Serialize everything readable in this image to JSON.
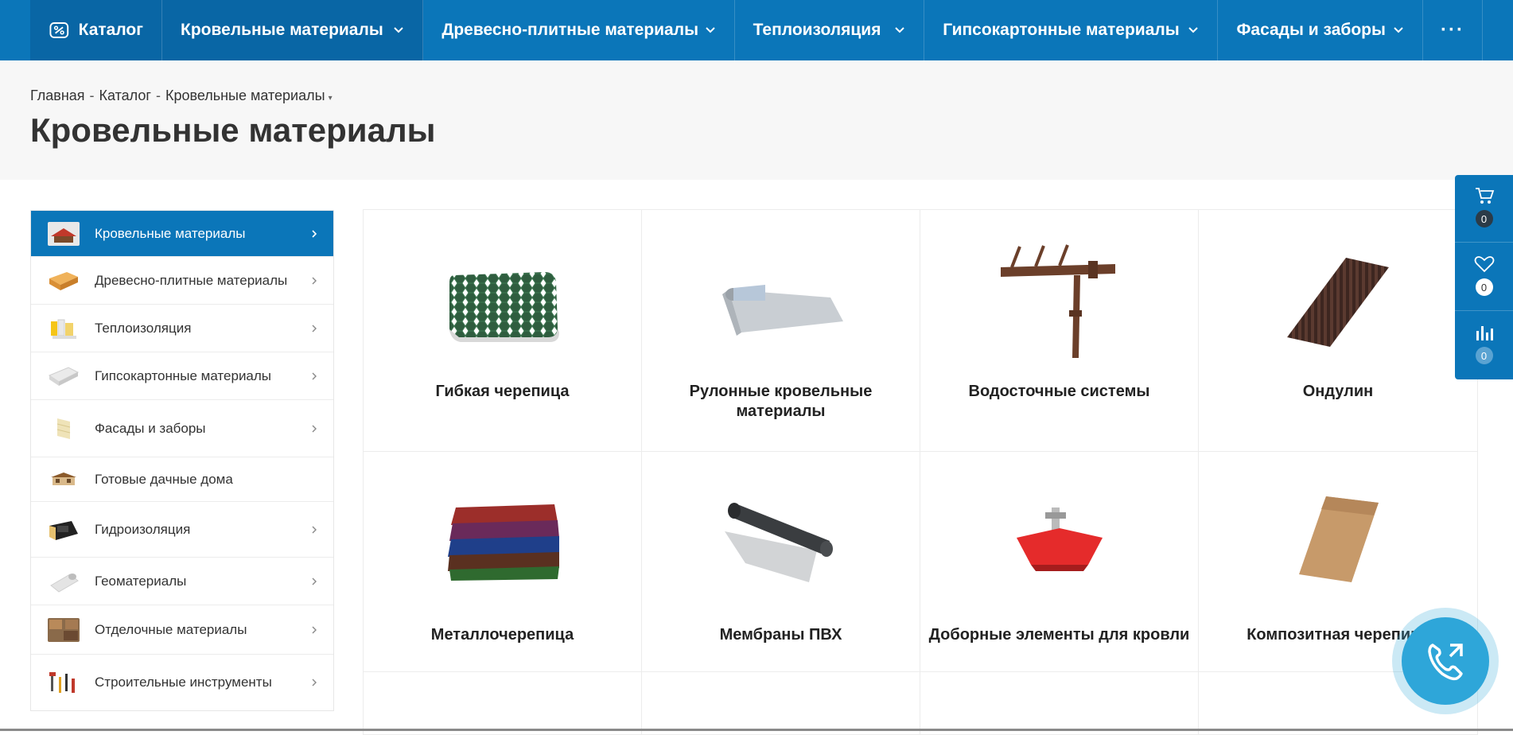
{
  "topnav": {
    "catalog_label": "Каталог",
    "items": [
      {
        "label": "Кровельные материалы"
      },
      {
        "label": "Древесно-плитные материалы"
      },
      {
        "label": "Теплоизоляция"
      },
      {
        "label": "Гипсокартонные материалы"
      },
      {
        "label": "Фасады и заборы"
      }
    ],
    "more_label": "···"
  },
  "breadcrumb": {
    "home": "Главная",
    "catalog": "Каталог",
    "current": "Кровельные материалы",
    "separator": "-",
    "dropdown": "▾"
  },
  "page_title": "Кровельные материалы",
  "sidebar": {
    "items": [
      {
        "label": "Кровельные материалы",
        "icon": "roofing-thumb-icon"
      },
      {
        "label": "Древесно-плитные материалы",
        "icon": "wood-board-thumb-icon"
      },
      {
        "label": "Теплоизоляция",
        "icon": "insulation-thumb-icon"
      },
      {
        "label": "Гипсокартонные материалы",
        "icon": "drywall-thumb-icon"
      },
      {
        "label": "Фасады и заборы",
        "icon": "facade-thumb-icon"
      },
      {
        "label": "Готовые дачные дома",
        "icon": "house-thumb-icon"
      },
      {
        "label": "Гидроизоляция",
        "icon": "waterproofing-thumb-icon"
      },
      {
        "label": "Геоматериалы",
        "icon": "geomaterials-thumb-icon"
      },
      {
        "label": "Отделочные материалы",
        "icon": "finishing-thumb-icon"
      },
      {
        "label": "Строительные инструменты",
        "icon": "tools-thumb-icon"
      }
    ]
  },
  "categories": [
    {
      "name": "Гибкая черепица",
      "icon": "flexible-shingle-image"
    },
    {
      "name": "Рулонные кровельные материалы",
      "icon": "roll-roofing-image"
    },
    {
      "name": "Водосточные системы",
      "icon": "gutter-system-image"
    },
    {
      "name": "Ондулин",
      "icon": "ondulin-image"
    },
    {
      "name": "Металлочерепица",
      "icon": "metal-tile-image"
    },
    {
      "name": "Мембраны ПВХ",
      "icon": "pvc-membrane-image"
    },
    {
      "name": "Доборные элементы для кровли",
      "icon": "roof-accessory-image"
    },
    {
      "name": "Композитная черепица",
      "icon": "composite-tile-image"
    }
  ],
  "right_panel": {
    "cart_count": "0",
    "favorites_count": "0",
    "compare_count": "0"
  },
  "colors": {
    "brand_blue": "#0b76b9",
    "active_blue": "#0966a5",
    "call_button": "#2ea6d9"
  }
}
